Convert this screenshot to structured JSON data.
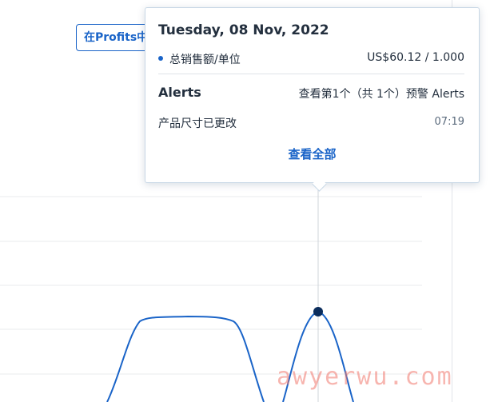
{
  "profits_button": {
    "label": "在Profits中"
  },
  "tooltip": {
    "date": "Tuesday, 08 Nov, 2022",
    "metric": {
      "label": "总销售额/单位",
      "value": "US$60.12 / 1.000",
      "color": "#1a64c8"
    },
    "alerts": {
      "title": "Alerts",
      "summary": "查看第1个（共 1个）预警 Alerts",
      "items": [
        {
          "text": "产品尺寸已更改",
          "time": "07:19"
        }
      ]
    },
    "view_all": "查看全部"
  },
  "chart_data": {
    "type": "line",
    "series": [
      {
        "color": "#1a64c8"
      }
    ],
    "highlighted_point": {
      "date": "2022-11-08",
      "value": 60.12
    },
    "grid": true
  },
  "watermark": "awyerwu.com"
}
